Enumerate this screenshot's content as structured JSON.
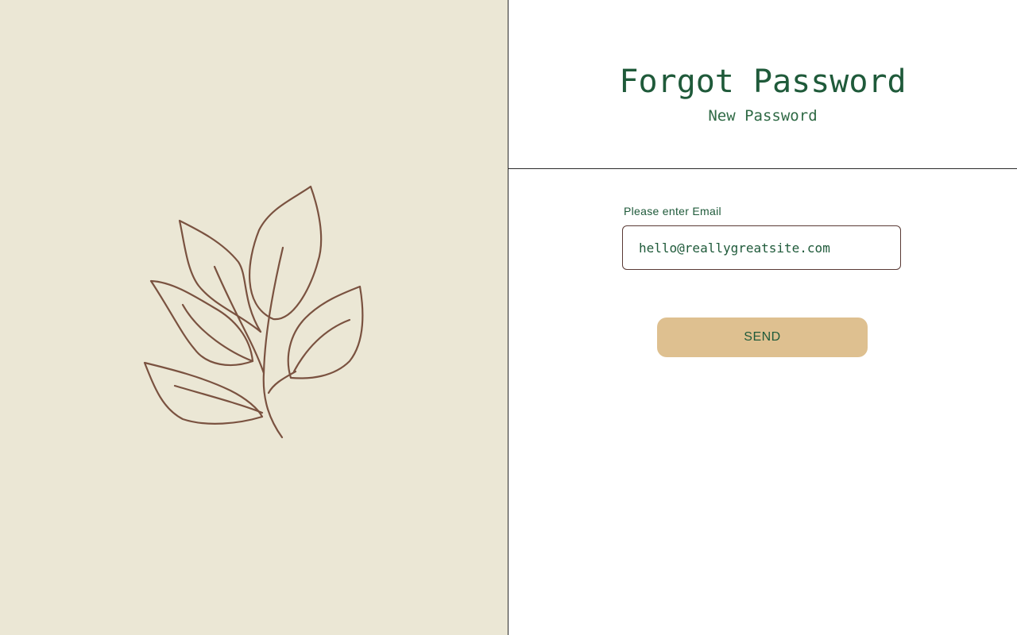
{
  "header": {
    "title": "Forgot Password",
    "subtitle": "New Password"
  },
  "form": {
    "email_label": "Please enter Email",
    "email_value": "hello@reallygreatsite.com",
    "send_label": "SEND"
  },
  "illustration": {
    "icon": "leaf-branch-icon",
    "stroke_color": "#7a5240"
  },
  "colors": {
    "left_background": "#ebe7d5",
    "accent_green": "#1f5a3a",
    "button_fill": "#dec090",
    "input_border": "#5a3a35"
  }
}
